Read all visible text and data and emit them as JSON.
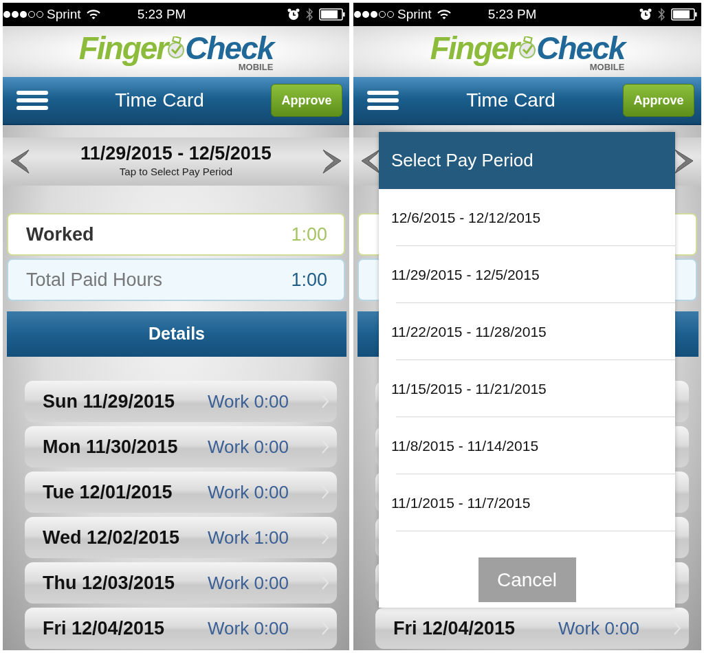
{
  "screens": [
    {
      "status_bar": {
        "carrier": "Sprint",
        "time": "5:23 PM"
      },
      "logo": {
        "word_1": "Finger",
        "word_2": "Check",
        "sub": "MOBILE"
      },
      "header": {
        "title": "Time Card",
        "approve_button": "Approve"
      },
      "pay_period": {
        "range": "11/29/2015 - 12/5/2015",
        "hint": "Tap to Select Pay Period"
      },
      "summary": [
        {
          "label": "Worked",
          "value": "1:00",
          "kind": "worked"
        },
        {
          "label": "Total Paid Hours",
          "value": "1:00",
          "kind": "paid"
        }
      ],
      "details_title": "Details",
      "days": [
        {
          "date": "Sun 11/29/2015",
          "work": "Work 0:00"
        },
        {
          "date": "Mon 11/30/2015",
          "work": "Work 0:00"
        },
        {
          "date": "Tue 12/01/2015",
          "work": "Work 0:00"
        },
        {
          "date": "Wed 12/02/2015",
          "work": "Work 1:00"
        },
        {
          "date": "Thu 12/03/2015",
          "work": "Work 0:00"
        },
        {
          "date": "Fri 12/04/2015",
          "work": "Work 0:00"
        }
      ]
    },
    {
      "status_bar": {
        "carrier": "Sprint",
        "time": "5:23 PM"
      },
      "logo": {
        "word_1": "Finger",
        "word_2": "Check",
        "sub": "MOBILE"
      },
      "header": {
        "title": "Time Card",
        "approve_button": "Approve"
      },
      "days": [
        {
          "date": "Fri 12/04/2015",
          "work": "Work 0:00"
        }
      ],
      "dialog": {
        "title": "Select Pay Period",
        "options": [
          "12/6/2015 - 12/12/2015",
          "11/29/2015 - 12/5/2015",
          "11/22/2015 - 11/28/2015",
          "11/15/2015 - 11/21/2015",
          "11/8/2015 - 11/14/2015",
          "11/1/2015 - 11/7/2015"
        ],
        "cancel": "Cancel"
      }
    }
  ]
}
